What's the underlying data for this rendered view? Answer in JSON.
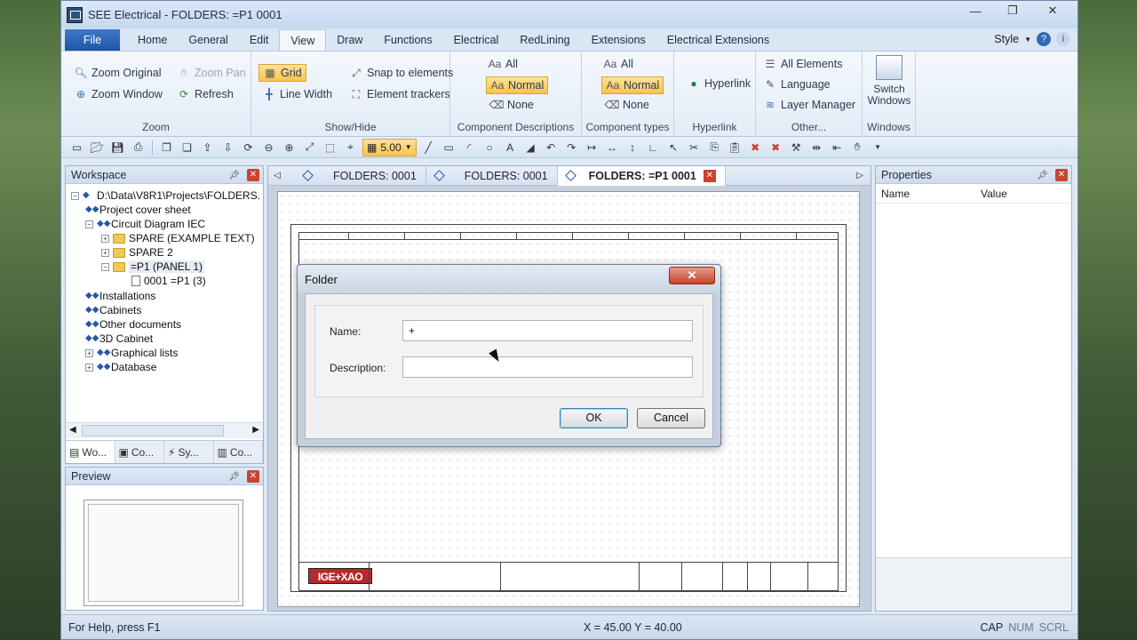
{
  "window": {
    "title": "SEE Electrical - FOLDERS: =P1 0001"
  },
  "menu": {
    "tabs": [
      "File",
      "Home",
      "General",
      "Edit",
      "View",
      "Draw",
      "Functions",
      "Electrical",
      "RedLining",
      "Extensions",
      "Electrical Extensions"
    ],
    "active": "View",
    "style_label": "Style"
  },
  "ribbon": {
    "zoom": {
      "label": "Zoom",
      "zoom_original": "Zoom Original",
      "zoom_pan": "Zoom Pan",
      "zoom_window": "Zoom Window",
      "refresh": "Refresh"
    },
    "showhide": {
      "label": "Show/Hide",
      "grid": "Grid",
      "line_width": "Line Width",
      "snap": "Snap to elements",
      "trackers": "Element trackers"
    },
    "compdesc": {
      "label": "Component Descriptions",
      "all": "All",
      "normal": "Normal",
      "none": "None"
    },
    "comptypes": {
      "label": "Component types",
      "all": "All",
      "normal": "Normal",
      "none": "None"
    },
    "hyperlink": {
      "label": "Hyperlink",
      "button": "Hyperlink"
    },
    "other": {
      "label": "Other...",
      "all_elements": "All Elements",
      "language": "Language",
      "layer_manager": "Layer Manager"
    },
    "windows": {
      "label": "Windows",
      "switch_line1": "Switch",
      "switch_line2": "Windows"
    }
  },
  "toolbar": {
    "grid_value": "5.00"
  },
  "workspace": {
    "title": "Workspace",
    "tree": [
      {
        "label": "D:\\Data\\V8R1\\Projects\\FOLDERS."
      },
      {
        "label": "Project cover sheet"
      },
      {
        "label": "Circuit Diagram IEC"
      },
      {
        "label": "SPARE (EXAMPLE TEXT)"
      },
      {
        "label": "SPARE 2"
      },
      {
        "label": "=P1 (PANEL 1)"
      },
      {
        "label": "0001 =P1 (3)"
      },
      {
        "label": "Installations"
      },
      {
        "label": "Cabinets"
      },
      {
        "label": "Other documents"
      },
      {
        "label": "3D Cabinet"
      },
      {
        "label": "Graphical lists"
      },
      {
        "label": "Database"
      }
    ],
    "tabs": [
      "Wo...",
      "Co...",
      "Sy...",
      "Co..."
    ]
  },
  "preview": {
    "title": "Preview"
  },
  "documents": {
    "tabs": [
      "FOLDERS: 0001",
      "FOLDERS: 0001",
      "FOLDERS: =P1 0001"
    ]
  },
  "drawing": {
    "logo": "IGE+XAO"
  },
  "dialog": {
    "title": "Folder",
    "name_label": "Name:",
    "name_value": "+",
    "description_label": "Description:",
    "description_value": "",
    "ok": "OK",
    "cancel": "Cancel"
  },
  "properties": {
    "title": "Properties",
    "col_name": "Name",
    "col_value": "Value"
  },
  "status": {
    "help": "For Help, press F1",
    "coords": "X = 45.00  Y = 40.00",
    "cap": "CAP",
    "num": "NUM",
    "scrl": "SCRL"
  }
}
